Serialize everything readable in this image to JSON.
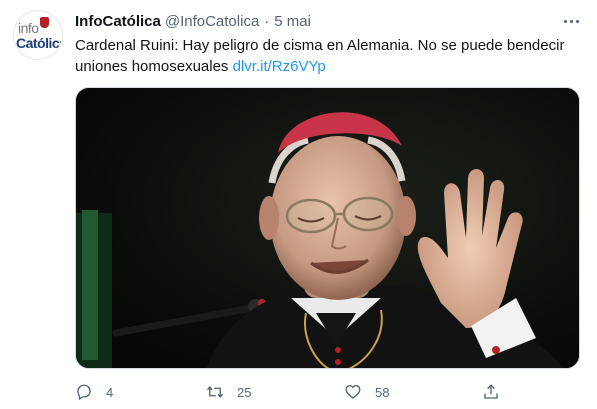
{
  "tweet": {
    "avatar": {
      "top_text": "info",
      "bottom_text": "Católica"
    },
    "display_name": "InfoCatólica",
    "handle": "@InfoCatolica",
    "separator": "·",
    "date": "5 mai",
    "text_plain": "Cardenal Ruini: Hay peligro de cisma en Alemania. No se puede bendecir uniones homosexuales ",
    "link": "dlvr.it/Rz6VYp"
  },
  "actions": {
    "reply_count": "4",
    "retweet_count": "25",
    "like_count": "58"
  },
  "colors": {
    "link": "#1d9bf0",
    "secondary": "#536471",
    "cardinal_cap": "#c8354a"
  }
}
